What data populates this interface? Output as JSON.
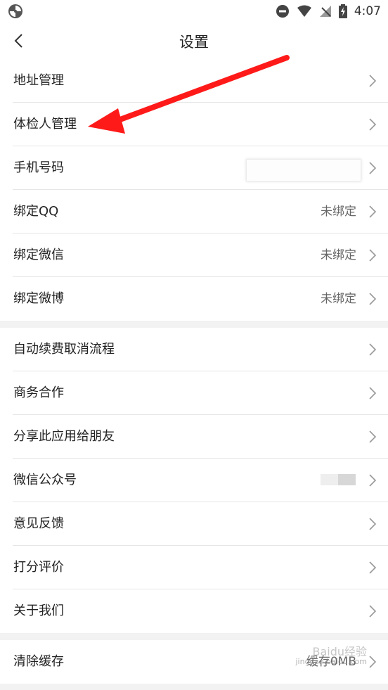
{
  "status": {
    "time": "4:07",
    "icons": [
      "app-circle-icon",
      "do-not-disturb-icon",
      "wifi-icon",
      "signal-off-icon",
      "battery-charging-icon"
    ]
  },
  "header": {
    "title": "设置",
    "back_icon": "chevron-left-icon"
  },
  "groups": [
    {
      "items": [
        {
          "label": "地址管理",
          "value": ""
        },
        {
          "label": "体检人管理",
          "value": ""
        },
        {
          "label": "手机号码",
          "value": ""
        },
        {
          "label": "绑定QQ",
          "value": "未绑定"
        },
        {
          "label": "绑定微信",
          "value": "未绑定"
        },
        {
          "label": "绑定微博",
          "value": "未绑定"
        }
      ]
    },
    {
      "items": [
        {
          "label": "自动续费取消流程",
          "value": ""
        },
        {
          "label": "商务合作",
          "value": ""
        },
        {
          "label": "分享此应用给朋友",
          "value": ""
        },
        {
          "label": "微信公众号",
          "value": ""
        },
        {
          "label": "意见反馈",
          "value": ""
        },
        {
          "label": "打分评价",
          "value": ""
        },
        {
          "label": "关于我们",
          "value": ""
        }
      ]
    },
    {
      "items": [
        {
          "label": "清除缓存",
          "value": "缓存0MB"
        }
      ]
    }
  ],
  "annotation": {
    "color": "#ff1a1a"
  },
  "watermark": {
    "line1": "Baidu经验",
    "line2": "jingyan.baidu.com"
  }
}
